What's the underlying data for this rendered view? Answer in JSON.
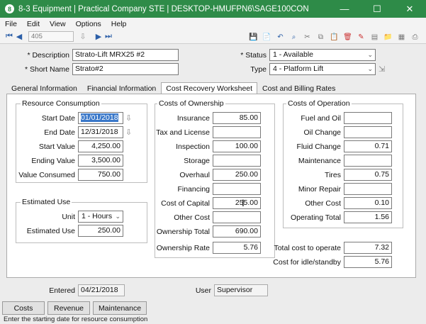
{
  "window": {
    "title": "8-3 Equipment | Practical Company STE | DESKTOP-HMUFPN6\\SAGE100CON",
    "app_icon": "8",
    "min_glyph": "—",
    "max_glyph": "☐",
    "close_glyph": "✕"
  },
  "menu": [
    "File",
    "Edit",
    "View",
    "Options",
    "Help"
  ],
  "toolbar": {
    "record": "405",
    "first_icon": "first-record-icon",
    "prev_icon": "previous-record-icon",
    "next_icon": "next-record-icon",
    "last_icon": "last-record-icon",
    "lookup_icon": "lookup-icon"
  },
  "header": {
    "description_label": "* Description",
    "description_value": "Strato-Lift MRX25 #2",
    "short_name_label": "* Short Name",
    "short_name_value": "Strato#2",
    "status_label": "* Status",
    "status_value": "1 - Available",
    "type_label": "Type",
    "type_value": "4 - Platform Lift"
  },
  "tabs": [
    "General Information",
    "Financial Information",
    "Cost Recovery Worksheet",
    "Cost and Billing Rates"
  ],
  "resource": {
    "title": "Resource Consumption",
    "start_date_label": "Start Date",
    "start_date_value": "01/01/2018",
    "end_date_label": "End Date",
    "end_date_value": "12/31/2018",
    "start_value_label": "Start Value",
    "start_value_value": "4,250.00",
    "ending_value_label": "Ending Value",
    "ending_value_value": "3,500.00",
    "value_consumed_label": "Value Consumed",
    "value_consumed_value": "750.00"
  },
  "estimated": {
    "title": "Estimated Use",
    "unit_label": "Unit",
    "unit_value": "1 - Hours",
    "use_label": "Estimated Use",
    "use_value": "250.00"
  },
  "ownership": {
    "title": "Costs of Ownership",
    "rows": [
      {
        "label": "Insurance",
        "value": "85.00"
      },
      {
        "label": "Tax and License",
        "value": ""
      },
      {
        "label": "Inspection",
        "value": "100.00"
      },
      {
        "label": "Storage",
        "value": ""
      },
      {
        "label": "Overhaul",
        "value": "250.00"
      },
      {
        "label": "Financing",
        "value": ""
      },
      {
        "label": "Cost of Capital",
        "value": "255.00"
      },
      {
        "label": "Other Cost",
        "value": ""
      },
      {
        "label": "Ownership Total",
        "value": "690.00"
      }
    ],
    "rate_label": "Ownership Rate",
    "rate_value": "5.76"
  },
  "operation": {
    "title": "Costs of Operation",
    "rows": [
      {
        "label": "Fuel and Oil",
        "value": ""
      },
      {
        "label": "Oil Change",
        "value": ""
      },
      {
        "label": "Fluid Change",
        "value": "0.71"
      },
      {
        "label": "Maintenance",
        "value": ""
      },
      {
        "label": "Tires",
        "value": "0.75"
      },
      {
        "label": "Minor Repair",
        "value": ""
      },
      {
        "label": "Other Cost",
        "value": "0.10"
      },
      {
        "label": "Operating Total",
        "value": "1.56"
      }
    ],
    "total_operate_label": "Total cost to operate",
    "total_operate_value": "7.32",
    "idle_label": "Cost for idle/standby",
    "idle_value": "5.76"
  },
  "footer": {
    "entered_label": "Entered",
    "entered_value": "04/21/2018",
    "user_label": "User",
    "user_value": "Supervisor",
    "buttons": [
      "Costs",
      "Revenue",
      "Maintenance"
    ],
    "status_text": "Enter the starting date for resource consumption"
  },
  "colors": {
    "titlebar": "#2e8b48",
    "selection": "#3a78c9"
  }
}
